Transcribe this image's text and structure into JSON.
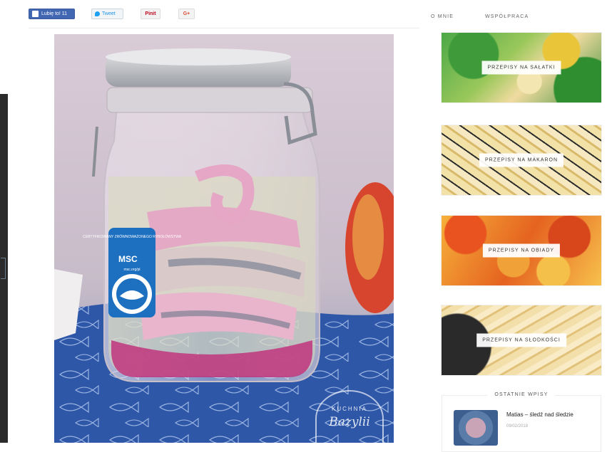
{
  "share_bar": {
    "facebook_label": "Lubię to! 11",
    "tweet_label": "Tweet",
    "pin_label": "Pinit",
    "gplus_label": "G+"
  },
  "nav": {
    "items": [
      "O MNIE",
      "WSPÓŁPRACA"
    ]
  },
  "photo": {
    "label": {
      "line1": "CERTYFIKOWANY ZRÓWNOWAŻONEGO RYBOŁÓWSTWA",
      "brand": "MSC",
      "line2": "msc.org/pl"
    },
    "watermark": {
      "line1": "KUCHNIA",
      "line2": "Bazylii"
    }
  },
  "sidebar": {
    "categories": [
      {
        "label": "PRZEPISY NA SAŁATKI"
      },
      {
        "label": "PRZEPISY NA MAKARON"
      },
      {
        "label": "PRZEPISY NA OBIADY"
      },
      {
        "label": "PRZEPISY NA SŁODKOŚCI"
      }
    ],
    "recent": {
      "title": "OSTATNIE WPISY",
      "post_title": "Matias – śledź nad śledzie",
      "post_date": "09/02/2018"
    }
  },
  "colors": {
    "facebook": "#4267b2",
    "twitter": "#1da1f2",
    "pinterest": "#bd081c",
    "gplus": "#dd4b39",
    "tablecloth": "#2f57a8",
    "msc_blue": "#1d6fc0"
  }
}
